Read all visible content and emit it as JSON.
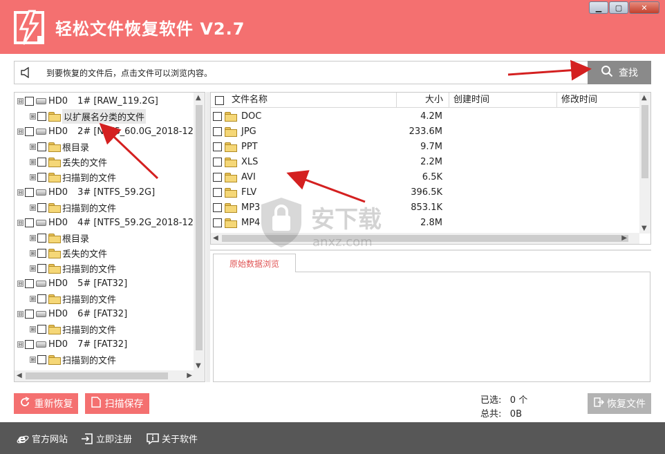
{
  "app": {
    "title": "轻松文件恢复软件 V2.7",
    "window_controls": {
      "minimize": "▁",
      "restore": "▢",
      "close": "✕"
    }
  },
  "notice": {
    "text": "到要恢复的文件后，点击文件可以浏览内容。",
    "search_label": "查找"
  },
  "tree": {
    "items": [
      {
        "level": 0,
        "expander": "⊟",
        "type": "drive",
        "disk": "HD0",
        "label": "1# [RAW_119.2G]"
      },
      {
        "level": 1,
        "expander": "⊞",
        "type": "folder",
        "label": "以扩展名分类的文件"
      },
      {
        "level": 0,
        "expander": "⊟",
        "type": "drive",
        "disk": "HD0",
        "label": "2# [NTFS_60.0G_2018-12-"
      },
      {
        "level": 1,
        "expander": "⊞",
        "type": "folder",
        "label": "根目录"
      },
      {
        "level": 1,
        "expander": "⊞",
        "type": "folder",
        "label": "丢失的文件"
      },
      {
        "level": 1,
        "expander": "⊞",
        "type": "folder",
        "label": "扫描到的文件"
      },
      {
        "level": 0,
        "expander": "⊟",
        "type": "drive",
        "disk": "HD0",
        "label": "3# [NTFS_59.2G]"
      },
      {
        "level": 1,
        "expander": "⊞",
        "type": "folder",
        "label": "扫描到的文件"
      },
      {
        "level": 0,
        "expander": "⊟",
        "type": "drive",
        "disk": "HD0",
        "label": "4# [NTFS_59.2G_2018-12-"
      },
      {
        "level": 1,
        "expander": "⊞",
        "type": "folder",
        "label": "根目录"
      },
      {
        "level": 1,
        "expander": "⊞",
        "type": "folder",
        "label": "丢失的文件"
      },
      {
        "level": 1,
        "expander": "⊞",
        "type": "folder",
        "label": "扫描到的文件"
      },
      {
        "level": 0,
        "expander": "⊟",
        "type": "drive",
        "disk": "HD0",
        "label": "5# [FAT32]"
      },
      {
        "level": 1,
        "expander": "⊞",
        "type": "folder",
        "label": "扫描到的文件"
      },
      {
        "level": 0,
        "expander": "⊟",
        "type": "drive",
        "disk": "HD0",
        "label": "6# [FAT32]"
      },
      {
        "level": 1,
        "expander": "⊞",
        "type": "folder",
        "label": "扫描到的文件"
      },
      {
        "level": 0,
        "expander": "⊟",
        "type": "drive",
        "disk": "HD0",
        "label": "7# [FAT32]"
      },
      {
        "level": 1,
        "expander": "⊞",
        "type": "folder",
        "label": "扫描到的文件"
      }
    ]
  },
  "filelist": {
    "columns": {
      "name": "文件名称",
      "size": "大小",
      "created": "创建时间",
      "modified": "修改时间"
    },
    "rows": [
      {
        "name": "DOC",
        "size": "4.2M"
      },
      {
        "name": "JPG",
        "size": "233.6M"
      },
      {
        "name": "PPT",
        "size": "9.7M"
      },
      {
        "name": "XLS",
        "size": "2.2M"
      },
      {
        "name": "AVI",
        "size": "6.5K"
      },
      {
        "name": "FLV",
        "size": "396.5K"
      },
      {
        "name": "MP3",
        "size": "853.1K"
      },
      {
        "name": "MP4",
        "size": "2.8M"
      }
    ]
  },
  "preview": {
    "tab_label": "原始数据浏览"
  },
  "actions": {
    "rescan": "重新恢复",
    "save_scan": "扫描保存",
    "recover": "恢复文件"
  },
  "stats": {
    "selected_label": "已选:",
    "selected_value": "0 个",
    "total_label": "总共:",
    "total_value": "0B"
  },
  "footer": {
    "website": "官方网站",
    "register": "立即注册",
    "about": "关于软件"
  },
  "watermark": {
    "text": "安下载",
    "sub": "anxz.com"
  },
  "colors": {
    "brand": "#f47070",
    "footer": "#575757",
    "arrow": "#d42020"
  }
}
